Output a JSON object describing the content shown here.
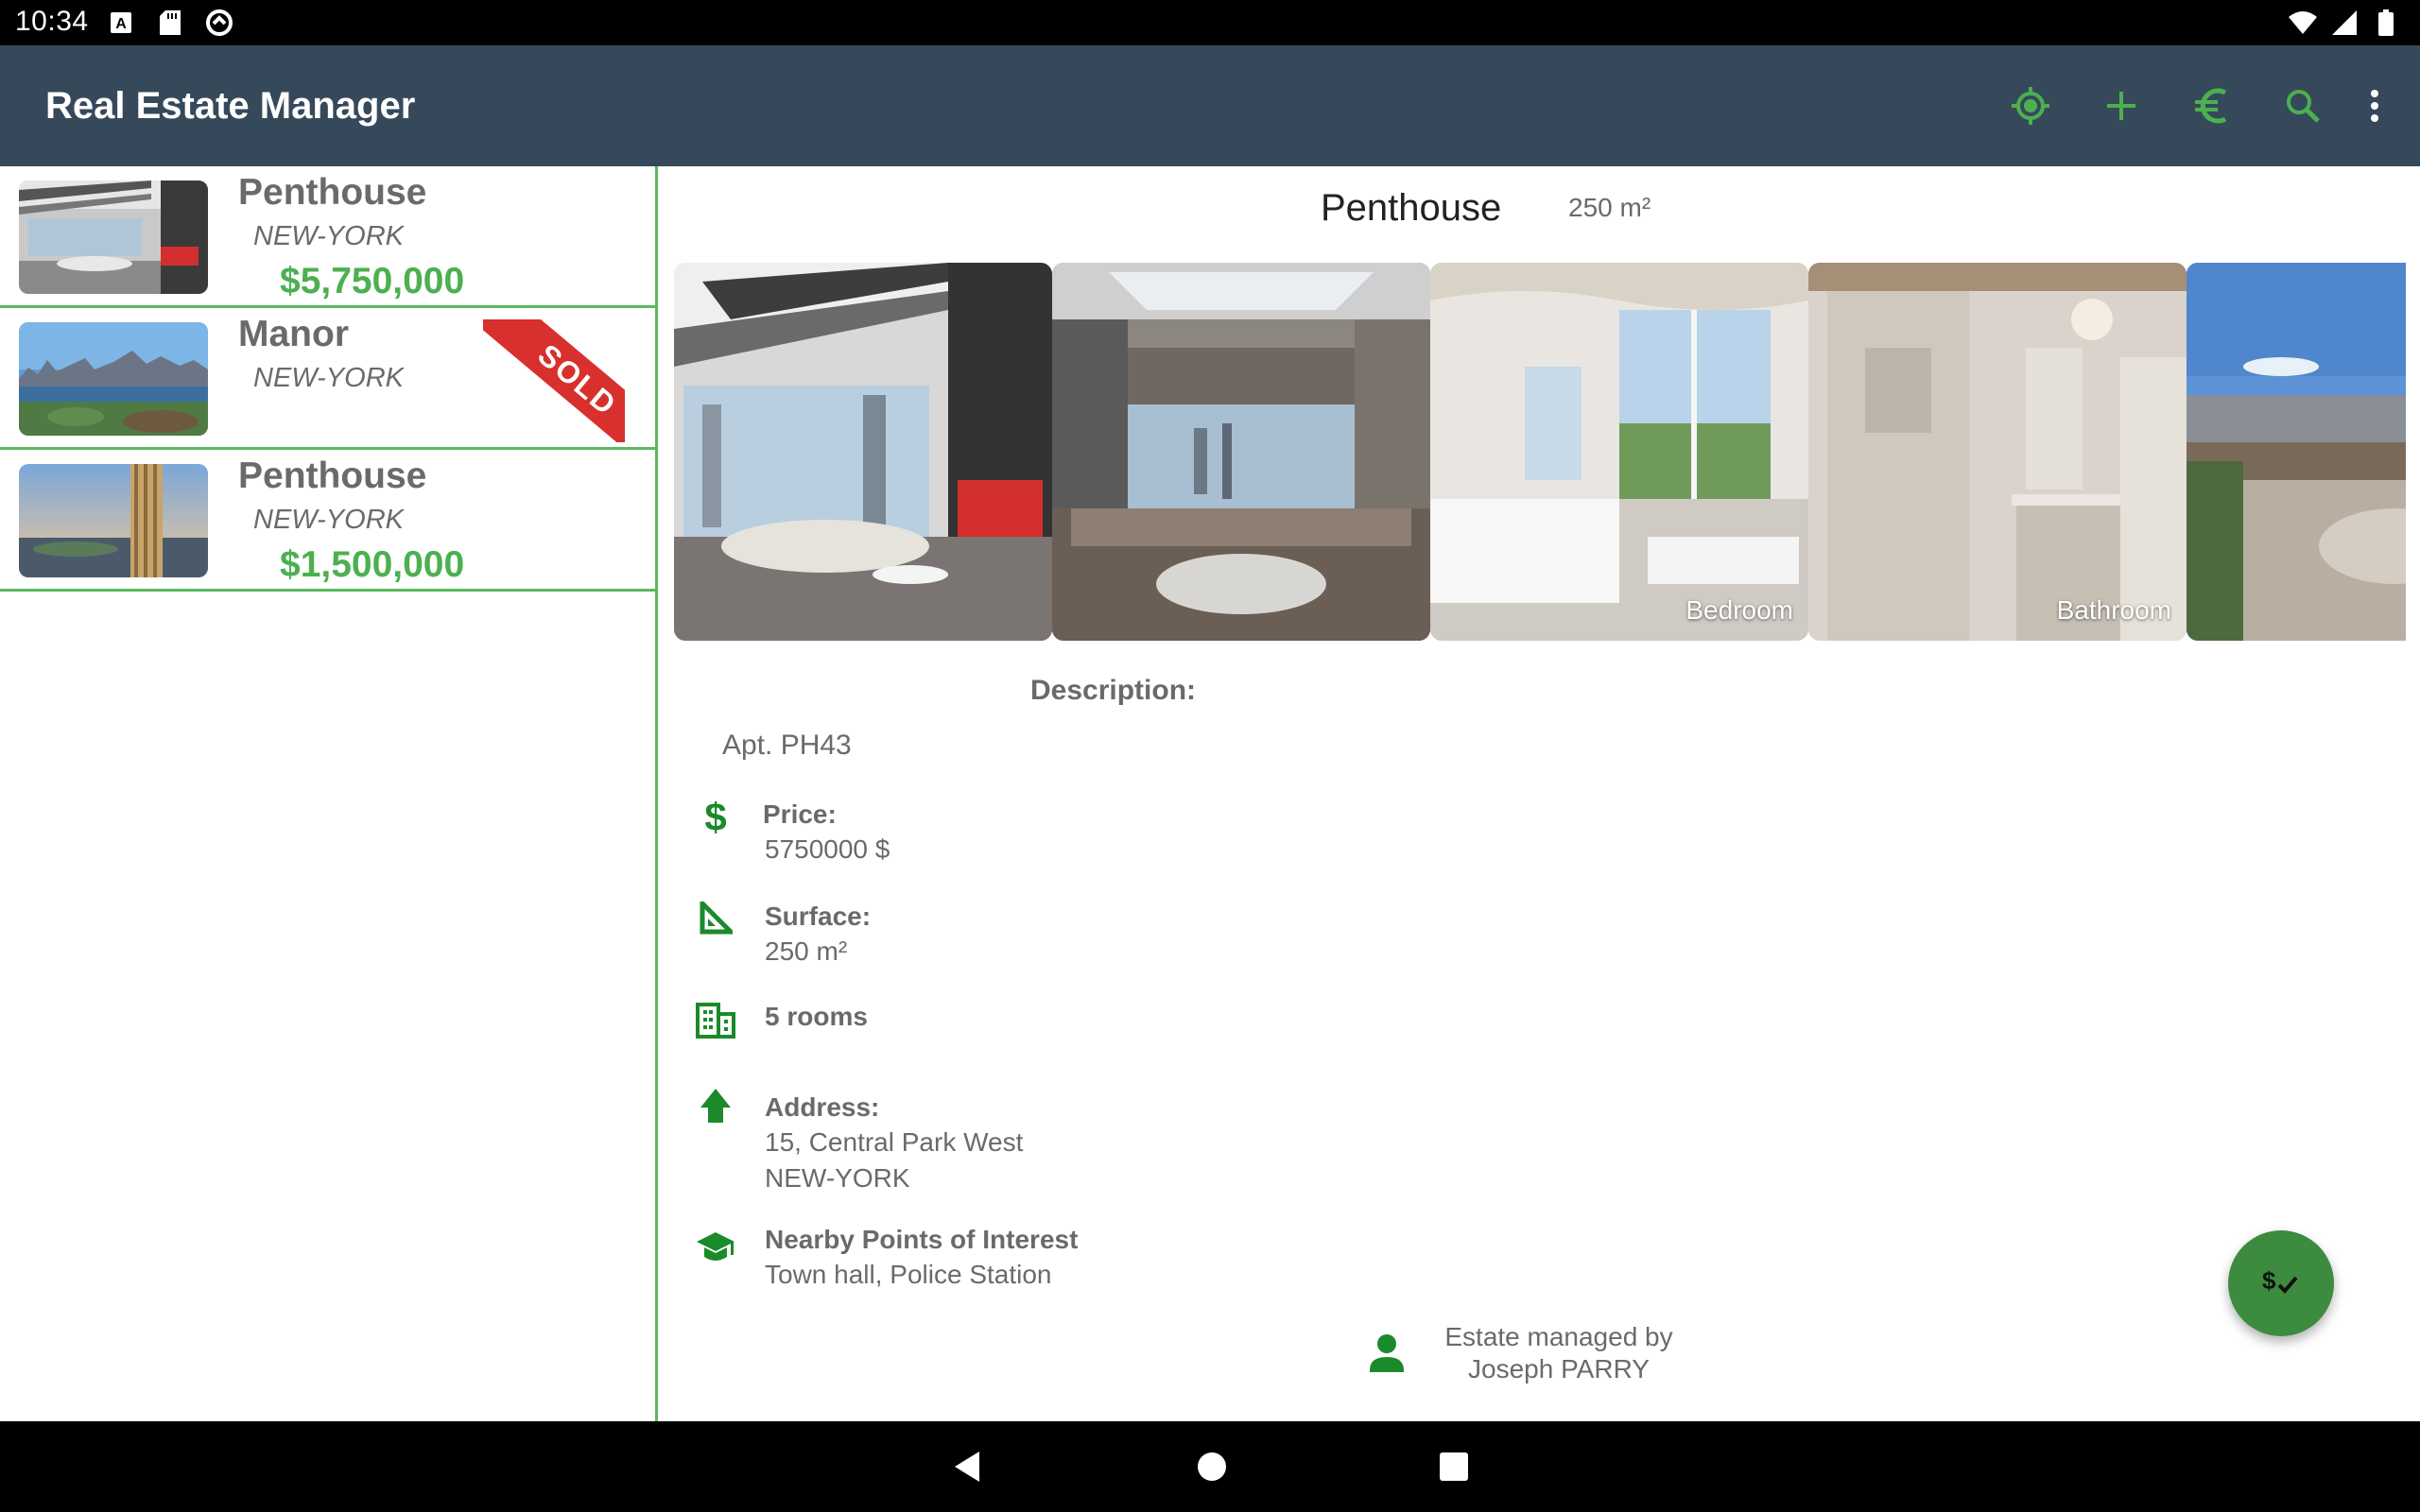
{
  "status_bar": {
    "time": "10:34",
    "left_icons": [
      "keyboard-a-icon",
      "sd-card-icon",
      "sync-circle-icon"
    ],
    "right_icons": [
      "wifi-icon",
      "cell-signal-icon",
      "battery-icon"
    ]
  },
  "app_bar": {
    "title": "Real Estate Manager",
    "actions": [
      "location-target-icon",
      "add-icon",
      "euro-icon",
      "search-icon",
      "more-vert-icon"
    ],
    "accent_color": "#4cb050",
    "background_color": "#36495b"
  },
  "list": {
    "items": [
      {
        "type": "Penthouse",
        "city": "NEW-YORK",
        "price": "$5,750,000",
        "sold": false
      },
      {
        "type": "Manor",
        "city": "NEW-YORK",
        "price": "",
        "sold": true,
        "sold_label": "SOLD"
      },
      {
        "type": "Penthouse",
        "city": "NEW-YORK",
        "price": "$1,500,000",
        "sold": false
      }
    ]
  },
  "detail": {
    "title": "Penthouse",
    "surface_header": "250 m²",
    "photos": [
      {
        "label": ""
      },
      {
        "label": ""
      },
      {
        "label": "Bedroom"
      },
      {
        "label": "Bathroom"
      },
      {
        "label": ""
      }
    ],
    "description_label": "Description:",
    "description": "Apt. PH43",
    "price_label": "Price:",
    "price_value": "5750000 $",
    "surface_label": "Surface:",
    "surface_value": "250 m²",
    "rooms": "5 rooms",
    "address_label": "Address:",
    "address_line1": "15, Central Park West",
    "address_line2": "NEW-YORK",
    "poi_label": "Nearby Points of Interest",
    "poi_value": "Town hall, Police Station",
    "manager_line1": "Estate managed by",
    "manager_line2": "Joseph PARRY"
  },
  "fab": {
    "icon": "dollar-check-icon"
  },
  "nav_bar": {
    "buttons": [
      "back-icon",
      "home-icon",
      "recents-icon"
    ]
  }
}
